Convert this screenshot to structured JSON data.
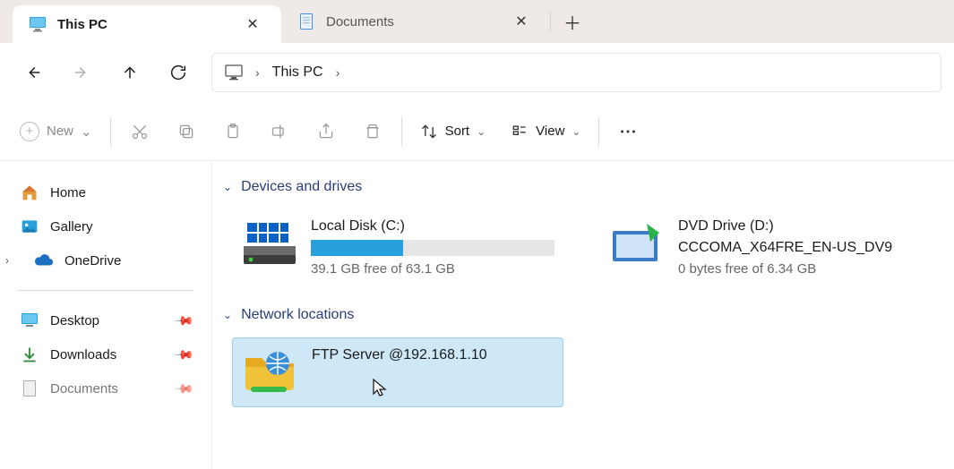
{
  "tabs": [
    {
      "title": "This PC",
      "icon": "monitor-icon",
      "active": true
    },
    {
      "title": "Documents",
      "icon": "document-icon",
      "active": false
    }
  ],
  "nav": {
    "breadcrumb": [
      "This PC"
    ]
  },
  "toolbar": {
    "new_label": "New",
    "sort_label": "Sort",
    "view_label": "View"
  },
  "sidebar": {
    "items": [
      {
        "label": "Home",
        "icon": "home-icon"
      },
      {
        "label": "Gallery",
        "icon": "gallery-icon"
      },
      {
        "label": "OneDrive",
        "icon": "onedrive-icon",
        "expandable": true
      }
    ],
    "quick": [
      {
        "label": "Desktop",
        "icon": "desktop-icon",
        "pinned": true
      },
      {
        "label": "Downloads",
        "icon": "downloads-icon",
        "pinned": true
      },
      {
        "label": "Documents",
        "icon": "documents-icon",
        "pinned": true
      }
    ]
  },
  "groups": [
    {
      "title": "Devices and drives",
      "items": [
        {
          "type": "local",
          "title": "Local Disk (C:)",
          "free_text": "39.1 GB free of 63.1 GB",
          "used_pct": 38
        },
        {
          "type": "dvd",
          "title": "DVD Drive (D:)",
          "subtitle": "CCCOMA_X64FRE_EN-US_DV9",
          "free_text": "0 bytes free of 6.34 GB"
        }
      ]
    },
    {
      "title": "Network locations",
      "items": [
        {
          "type": "ftp",
          "title": "FTP Server @192.168.1.10",
          "selected": true
        }
      ]
    }
  ]
}
